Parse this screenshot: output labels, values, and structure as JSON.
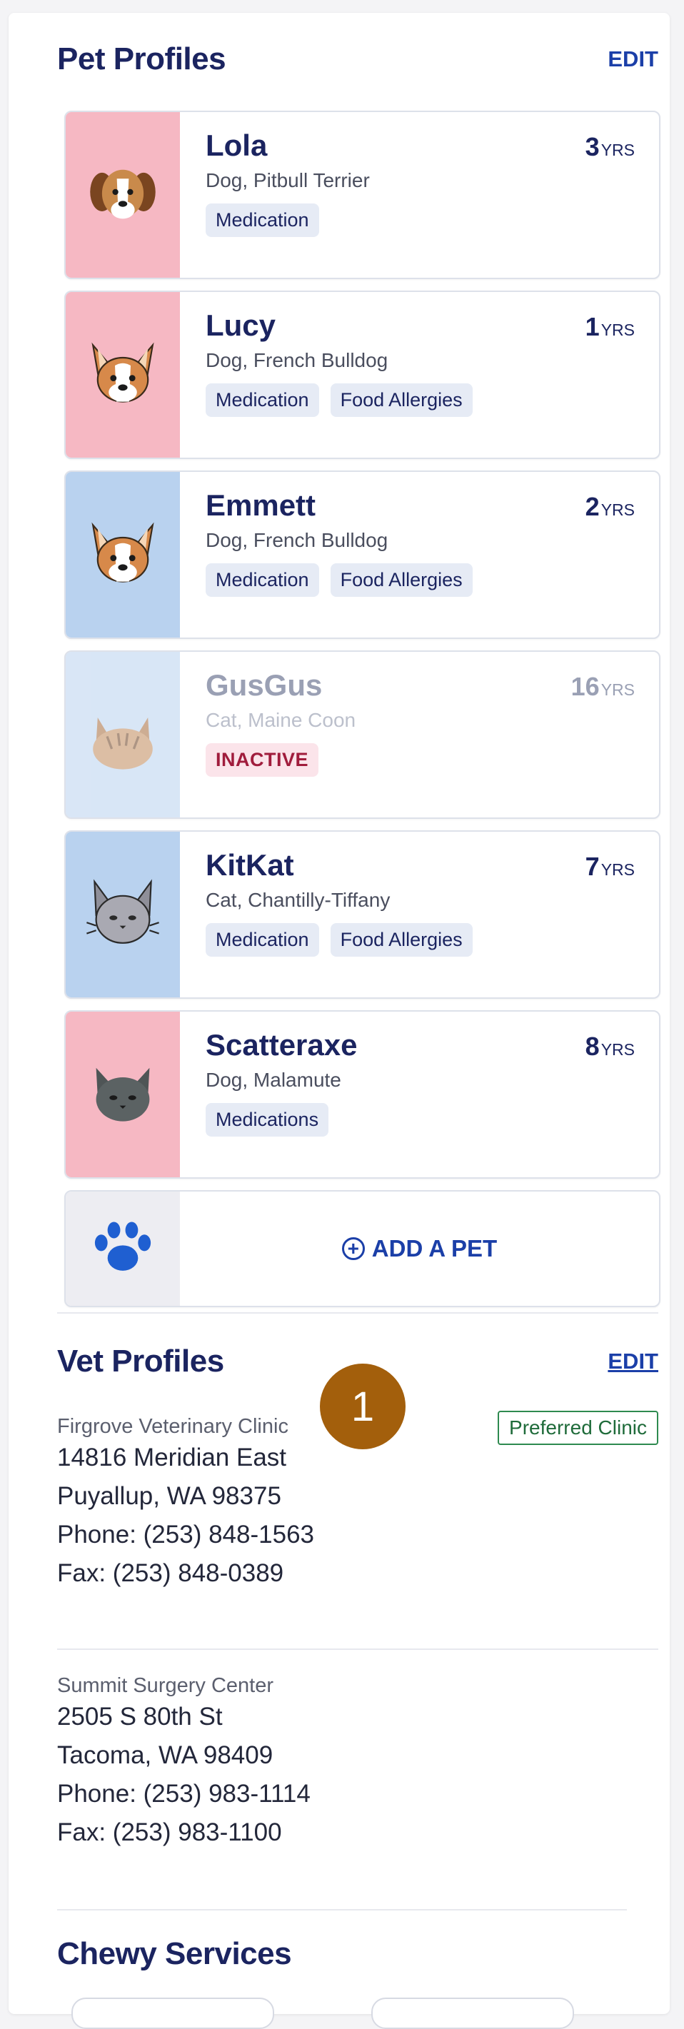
{
  "pets_section": {
    "title": "Pet Profiles",
    "edit_label": "EDIT"
  },
  "pets": [
    {
      "name": "Lola",
      "breed": "Dog, Pitbull Terrier",
      "age": "3",
      "age_unit": "YRS",
      "tags": [
        "Medication"
      ],
      "thumb_color": "pink",
      "icon": "beagle-icon",
      "inactive": false
    },
    {
      "name": "Lucy",
      "breed": "Dog, French Bulldog",
      "age": "1",
      "age_unit": "YRS",
      "tags": [
        "Medication",
        "Food Allergies"
      ],
      "thumb_color": "pink",
      "icon": "corgi-icon",
      "inactive": false
    },
    {
      "name": "Emmett",
      "breed": "Dog, French Bulldog",
      "age": "2",
      "age_unit": "YRS",
      "tags": [
        "Medication",
        "Food Allergies"
      ],
      "thumb_color": "blue",
      "icon": "corgi-icon",
      "inactive": false
    },
    {
      "name": "GusGus",
      "breed": "Cat, Maine Coon",
      "age": "16",
      "age_unit": "YRS",
      "tags": [
        "INACTIVE"
      ],
      "thumb_color": "blue",
      "icon": "tabby-cat-icon",
      "inactive": true
    },
    {
      "name": "KitKat",
      "breed": "Cat, Chantilly-Tiffany",
      "age": "7",
      "age_unit": "YRS",
      "tags": [
        "Medication",
        "Food Allergies"
      ],
      "thumb_color": "blue",
      "icon": "fluffy-cat-icon",
      "inactive": false
    },
    {
      "name": "Scatteraxe",
      "breed": "Dog, Malamute",
      "age": "8",
      "age_unit": "YRS",
      "tags": [
        "Medications"
      ],
      "thumb_color": "pink",
      "icon": "grey-cat-icon",
      "inactive": false
    }
  ],
  "add_pet": {
    "label": "ADD A PET",
    "icon": "paw-icon"
  },
  "vets_section": {
    "title": "Vet Profiles",
    "edit_label": "EDIT"
  },
  "vets": [
    {
      "name": "Firgrove Veterinary Clinic",
      "address1": "14816 Meridian East",
      "address2": "Puyallup, WA 98375",
      "phone": "Phone: (253) 848-1563",
      "fax": "Fax: (253) 848-0389",
      "badge": "Preferred Clinic"
    },
    {
      "name": "Summit Surgery Center",
      "address1": "2505 S 80th St",
      "address2": "Tacoma, WA 98409",
      "phone": "Phone: (253) 983-1114",
      "fax": "Fax: (253) 983-1100"
    }
  ],
  "step_marker": "1",
  "services_section": {
    "title": "Chewy Services"
  },
  "colors": {
    "brand": "#1b2460",
    "link": "#1b3fa8",
    "pink": "#f6b8c3",
    "blue": "#b9d2ef",
    "inactive": "#a01c3c",
    "preferred": "#2e8a4f",
    "marker": "#a35f0c"
  }
}
